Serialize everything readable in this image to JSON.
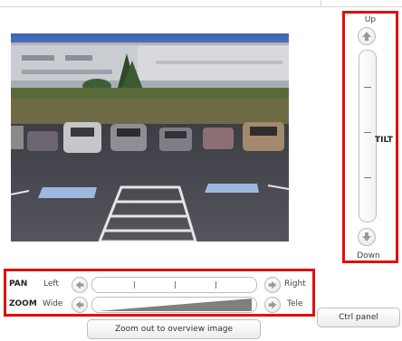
{
  "tilt": {
    "label": "TILT",
    "up_label": "Up",
    "down_label": "Down",
    "icons": {
      "up": "arrow-up-icon",
      "down": "arrow-down-icon"
    }
  },
  "pan": {
    "label": "PAN",
    "left_label": "Left",
    "right_label": "Right",
    "icons": {
      "left": "arrow-left-icon",
      "right": "arrow-right-icon"
    }
  },
  "zoom": {
    "label": "ZOOM",
    "wide_label": "Wide",
    "tele_label": "Tele",
    "icons": {
      "wide": "arrow-left-icon",
      "tele": "arrow-right-icon"
    }
  },
  "buttons": {
    "overview": "Zoom out to overview image",
    "ctrl_panel": "Ctrl panel"
  },
  "colors": {
    "highlight": "#e01010",
    "control_border": "#bdbdbd",
    "arrow": "#9a9a9a"
  }
}
